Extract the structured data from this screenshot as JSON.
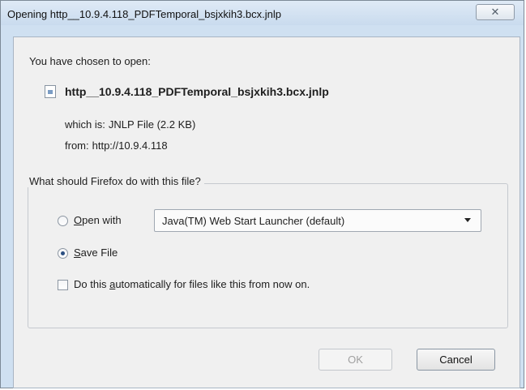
{
  "window": {
    "title": "Opening http__10.9.4.118_PDFTemporal_bsjxkih3.bcx.jnlp",
    "close_glyph": "✕"
  },
  "dialog": {
    "heading": "You have chosen to open:",
    "file_name": "http__10.9.4.118_PDFTemporal_bsjxkih3.bcx.jnlp",
    "type_label": "which is:",
    "type_value": "JNLP File (2.2 KB)",
    "from_label": "from:",
    "from_value": "http://10.9.4.118"
  },
  "actions": {
    "group_label": "What should Firefox do with this file?",
    "open_with_mnemonic": "O",
    "open_with_rest": "pen with",
    "open_with_selected": false,
    "application_select_value": "Java(TM) Web Start Launcher (default)",
    "save_file_mnemonic": "S",
    "save_file_rest": "ave File",
    "save_file_selected": true,
    "auto_prefix": "Do this ",
    "auto_mnemonic": "a",
    "auto_rest": "utomatically for files like this from now on.",
    "auto_checked": false
  },
  "buttons": {
    "ok_label": "OK",
    "ok_enabled": false,
    "cancel_label": "Cancel"
  },
  "icons": {
    "file": "jnlp-file-icon",
    "close": "close-icon",
    "dropdown": "chevron-down-icon"
  }
}
